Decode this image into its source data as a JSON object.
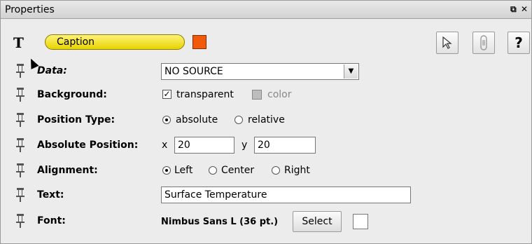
{
  "window": {
    "title": "Properties",
    "controls": {
      "float_icon": "float-icon",
      "close_icon": "close-icon"
    }
  },
  "caption": {
    "type_icon": "T",
    "label": "Caption",
    "color": "#f05a0a"
  },
  "toolbar": {
    "pointer_icon": "pointer-icon",
    "lock_icon": "lock-icon",
    "help_label": "?"
  },
  "rows": {
    "data": {
      "label": "Data:",
      "select_value": "NO SOURCE"
    },
    "background": {
      "label": "Background:",
      "transparent_checked": true,
      "transparent_label": "transparent",
      "color_label": "color"
    },
    "position_type": {
      "label": "Position Type:",
      "options": [
        "absolute",
        "relative"
      ],
      "selected": "absolute"
    },
    "absolute_position": {
      "label": "Absolute Position:",
      "x_label": "x",
      "x_value": "20",
      "y_label": "y",
      "y_value": "20"
    },
    "alignment": {
      "label": "Alignment:",
      "options": [
        "Left",
        "Center",
        "Right"
      ],
      "selected": "Left"
    },
    "text": {
      "label": "Text:",
      "value": "Surface Temperature"
    },
    "font": {
      "label": "Font:",
      "value": "Nimbus Sans L (36 pt.)",
      "select_label": "Select"
    }
  }
}
